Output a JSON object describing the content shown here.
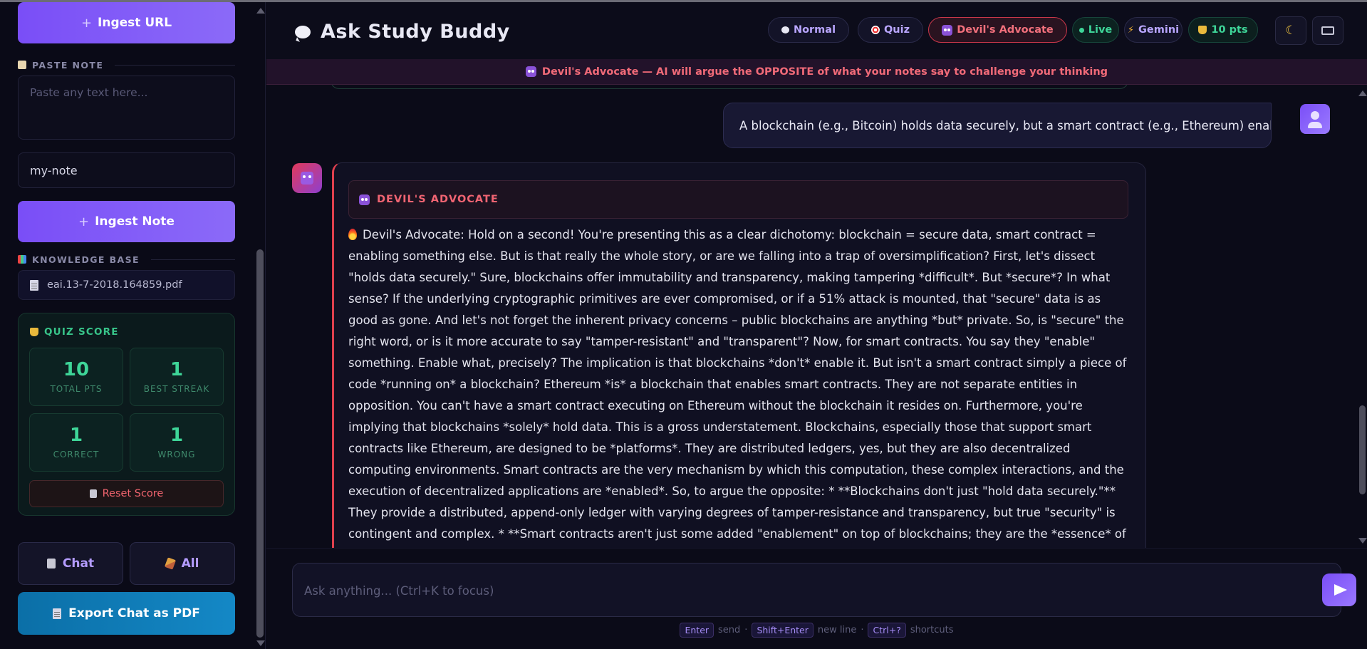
{
  "sidebar": {
    "ingest_url_label": "Ingest URL",
    "paste_note_label": "PASTE NOTE",
    "paste_placeholder": "Paste any text here...",
    "note_name_value": "my-note",
    "ingest_note_label": "Ingest Note",
    "knowledge_base_label": "KNOWLEDGE BASE",
    "files": [
      "eai.13-7-2018.164859.pdf"
    ],
    "quiz": {
      "title": "QUIZ SCORE",
      "total_pts": "10",
      "total_pts_label": "TOTAL PTS",
      "best_streak": "1",
      "best_streak_label": "BEST STREAK",
      "correct": "1",
      "correct_label": "CORRECT",
      "wrong": "1",
      "wrong_label": "WRONG",
      "reset_label": "Reset Score"
    },
    "chat_btn_label": "Chat",
    "all_btn_label": "All",
    "export_label": "Export Chat as PDF"
  },
  "header": {
    "title": "Ask Study Buddy",
    "modes": {
      "normal": "Normal",
      "quiz": "Quiz",
      "devil": "Devil's Advocate",
      "live": "Live",
      "gemini": "Gemini",
      "points": "10 pts"
    }
  },
  "banner": "Devil's Advocate — AI will argue the OPPOSITE of what your notes say to challenge your thinking",
  "chat": {
    "user_message": "A blockchain (e.g., Bitcoin) holds data securely, but a smart contract (e.g., Ethereum) enables",
    "bot_role": "DEVIL'S ADVOCATE",
    "bot_message": "Devil's Advocate: Hold on a second! You're presenting this as a clear dichotomy: blockchain = secure data, smart contract = enabling something else. But is that really the whole story, or are we falling into a trap of oversimplification? First, let's dissect \"holds data securely.\" Sure, blockchains offer immutability and transparency, making tampering *difficult*. But *secure*? In what sense? If the underlying cryptographic primitives are ever compromised, or if a 51% attack is mounted, that \"secure\" data is as good as gone. And let's not forget the inherent privacy concerns – public blockchains are anything *but* private. So, is \"secure\" the right word, or is it more accurate to say \"tamper-resistant\" and \"transparent\"? Now, for smart contracts. You say they \"enable\" something. Enable what, precisely? The implication is that blockchains *don't* enable it. But isn't a smart contract simply a piece of code *running on* a blockchain? Ethereum *is* a blockchain that enables smart contracts. They are not separate entities in opposition. You can't have a smart contract executing on Ethereum without the blockchain it resides on. Furthermore, you're implying that blockchains *solely* hold data. This is a gross understatement. Blockchains, especially those that support smart contracts like Ethereum, are designed to be *platforms*. They are distributed ledgers, yes, but they are also decentralized computing environments. Smart contracts are the very mechanism by which this computation, these complex interactions, and the execution of decentralized applications are *enabled*. So, to argue the opposite: * **Blockchains don't just \"hold data securely.\"** They provide a distributed, append-only ledger with varying degrees of tamper-resistance and transparency, but true \"security\" is contingent and complex. * **Smart contracts aren't just some added \"enablement\" on top of blockchains; they are the *essence* of what makes advanced blockchains like Ethereum powerful.** They are the very reason blockchains transform from simple ledgers into platforms for complex, decentralized"
  },
  "composer": {
    "placeholder": "Ask anything... (Ctrl+K to focus)",
    "hint_enter": "Enter",
    "hint_send": "send",
    "hint_shift": "Shift+Enter",
    "hint_newline": "new line",
    "hint_ctrl": "Ctrl+?",
    "hint_shortcuts": "shortcuts"
  },
  "colors": {
    "accent": "#7a4ef7",
    "devil": "#f06472",
    "success": "#3ed598",
    "export": "#1488c6"
  }
}
